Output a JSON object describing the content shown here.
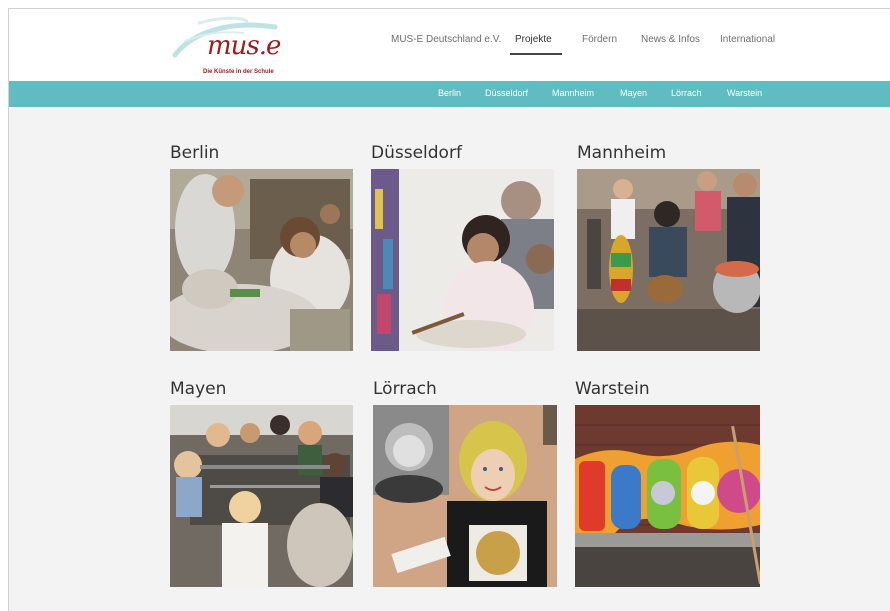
{
  "logo": {
    "wordmark": "mus.e",
    "tagline": "Die Künste in der Schule"
  },
  "main_nav": [
    {
      "label": "MUS-E Deutschland e.V.",
      "active": false
    },
    {
      "label": "Projekte",
      "active": true
    },
    {
      "label": "Fördern",
      "active": false
    },
    {
      "label": "News & Infos",
      "active": false
    },
    {
      "label": "International",
      "active": false
    }
  ],
  "sub_nav": [
    "Berlin",
    "Düsseldorf",
    "Mannheim",
    "Mayen",
    "Lörrach",
    "Warstein"
  ],
  "colors": {
    "accent": "#5fbcc0",
    "brand": "#9b1b1e",
    "active_underline": "#444444"
  },
  "projects": [
    {
      "title": "Berlin",
      "photo": "children-painting-sculpture-photo"
    },
    {
      "title": "Düsseldorf",
      "photo": "girl-painting-canvas-photo"
    },
    {
      "title": "Mannheim",
      "photo": "children-drumming-photo"
    },
    {
      "title": "Mayen",
      "photo": "children-crafting-table-photo"
    },
    {
      "title": "Lörrach",
      "photo": "self-portrait-collage-photo"
    },
    {
      "title": "Warstein",
      "photo": "colorful-wall-mural-photo"
    }
  ]
}
